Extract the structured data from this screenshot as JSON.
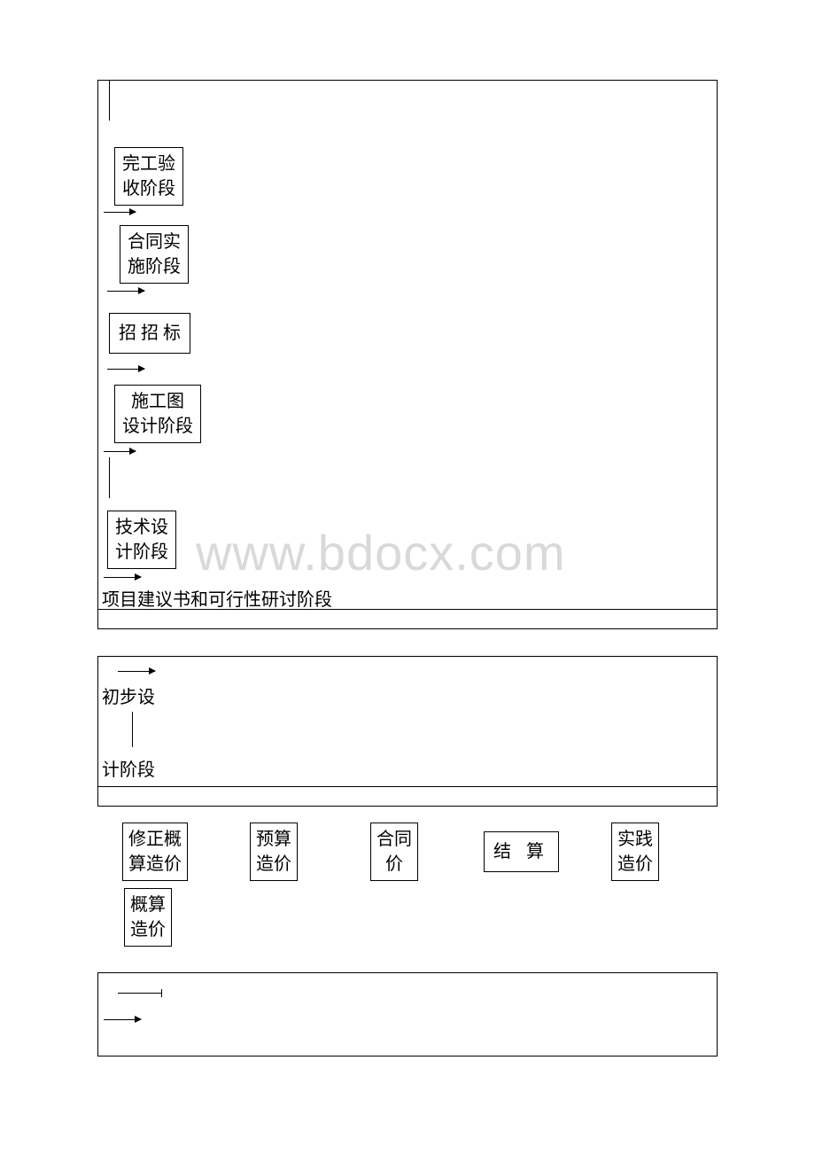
{
  "watermark": "www.bdocx.com",
  "box1": {
    "stages": {
      "s1": {
        "line1": "完工验",
        "line2": "收阶段"
      },
      "s2": {
        "line1": "合同实",
        "line2": "施阶段"
      },
      "s3": {
        "line1": "招 招 标"
      },
      "s4": {
        "line1": "施工图",
        "line2": "设计阶段"
      },
      "s5": {
        "line1": "技术设",
        "line2": "计阶段"
      },
      "bottom": "项目建议书和可行性研讨阶段"
    }
  },
  "box2": {
    "line1": "初步设",
    "line2": "计阶段"
  },
  "costs": {
    "c1": {
      "l1": "修正概",
      "l2": "算造价"
    },
    "c2": {
      "l1": "预算",
      "l2": "造价"
    },
    "c3": {
      "l1": "合同",
      "l2": "价"
    },
    "c4": {
      "l1": "结  算"
    },
    "c5": {
      "l1": "实践",
      "l2": "造价"
    },
    "c6": {
      "l1": "概算",
      "l2": "造价"
    }
  }
}
